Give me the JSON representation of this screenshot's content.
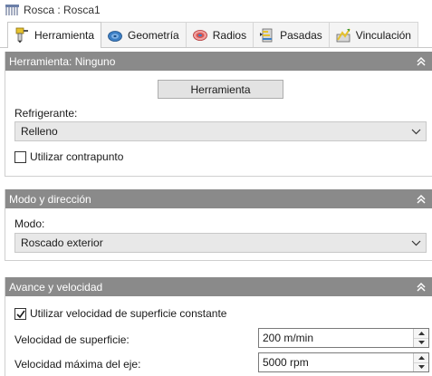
{
  "window": {
    "title": "Rosca : Rosca1"
  },
  "tabs": [
    {
      "label": "Herramienta",
      "icon": "tool-holder-icon",
      "active": true
    },
    {
      "label": "Geometría",
      "icon": "geometry-icon"
    },
    {
      "label": "Radios",
      "icon": "radii-icon"
    },
    {
      "label": "Pasadas",
      "icon": "passes-icon"
    },
    {
      "label": "Vinculación",
      "icon": "linking-icon"
    }
  ],
  "tool_panel": {
    "header": "Herramienta: Ninguno",
    "tool_button": "Herramienta",
    "coolant_label": "Refrigerante:",
    "coolant_value": "Relleno",
    "tailstock_label": "Utilizar contrapunto",
    "tailstock_checked": false
  },
  "mode_panel": {
    "header": "Modo y dirección",
    "mode_label": "Modo:",
    "mode_value": "Roscado exterior"
  },
  "feed_panel": {
    "header": "Avance y velocidad",
    "css_label": "Utilizar velocidad de superficie constante",
    "css_checked": true,
    "surface_speed_label": "Velocidad de superficie:",
    "surface_speed_value": "200 m/min",
    "max_spindle_label": "Velocidad máxima del eje:",
    "max_spindle_value": "5000 rpm"
  },
  "colors": {
    "panel_header": "#8a8a8a",
    "dropdown_bg": "#e8e8e8",
    "tool_yellow": "#e6c22e",
    "geometry_blue": "#3d7fc4",
    "radii_red": "#d9534f"
  }
}
